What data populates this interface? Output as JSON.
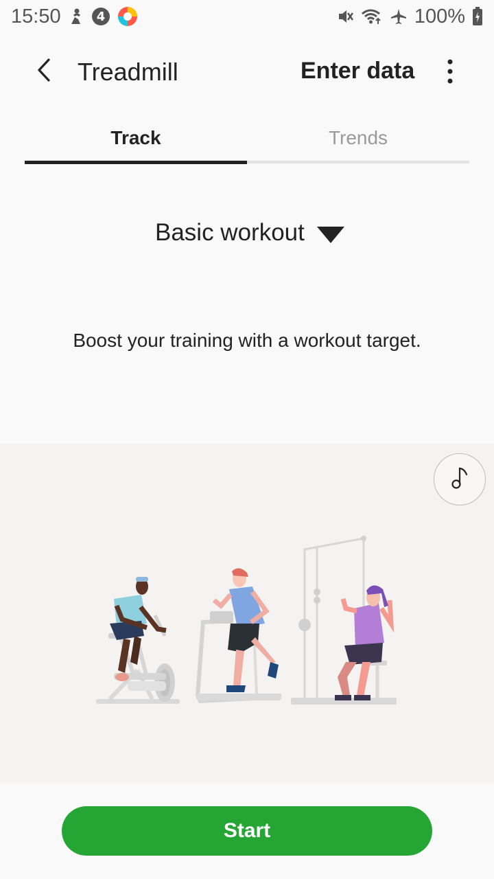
{
  "status_bar": {
    "time": "15:50",
    "left_icons": [
      "running-figure-icon",
      "number-4-badge-icon",
      "colorful-app-icon"
    ],
    "right_icons": [
      "mute-icon",
      "wifi-icon",
      "airplane-icon",
      "battery-charging-icon"
    ],
    "battery": "100%"
  },
  "appbar": {
    "title": "Treadmill",
    "action_label": "Enter data",
    "back_icon": "chevron-left-icon",
    "more_icon": "more-vertical-icon"
  },
  "tabs": [
    {
      "label": "Track",
      "selected": true
    },
    {
      "label": "Trends",
      "selected": false
    }
  ],
  "workout_selector": {
    "value": "Basic workout",
    "icon": "triangle-down-icon"
  },
  "tagline": "Boost your training with a workout target.",
  "illustration": {
    "description_icon": "gym-people-illustration",
    "music_icon": "music-note-icon"
  },
  "start_button": {
    "label": "Start"
  },
  "colors": {
    "accent": "#24a534",
    "background": "#f9f9f9",
    "panel": "#f5f3f2",
    "text": "#222222",
    "muted": "#9a9a9a"
  }
}
